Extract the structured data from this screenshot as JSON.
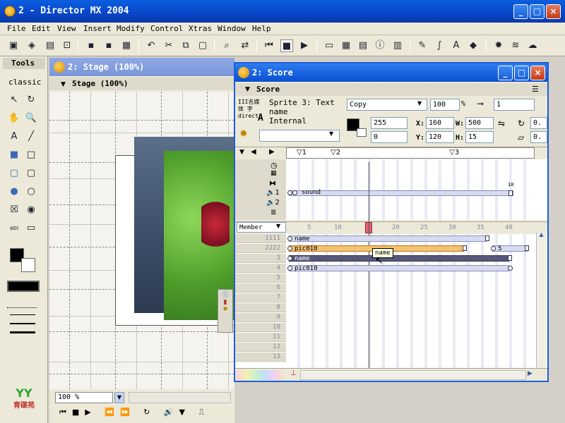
{
  "window": {
    "title": "2 - Director MX 2004"
  },
  "menu": [
    "File",
    "Edit",
    "View",
    "Insert",
    "Modify",
    "Control",
    "Xtras",
    "Window",
    "Help"
  ],
  "tools": {
    "title": "Tools",
    "mode": "classic"
  },
  "stage": {
    "title": "2: Stage (100%)",
    "subtitle": "Stage (100%)",
    "zoom": "100 %"
  },
  "score": {
    "title": "2: Score",
    "subtitle": "Score",
    "sprite_info": "Sprite 3: Text",
    "sprite_name_label": "name",
    "sprite_cast": "Internal",
    "thumb_text": "III名媒体 字 direct",
    "thumb_letter": "A",
    "ink": "Copy",
    "blend": "100",
    "blend_unit": "%",
    "frame_value": "1",
    "color_fg": "255",
    "color_bg": "0",
    "x_label": "X:",
    "x": "160",
    "y_label": "Y:",
    "y": "120",
    "w_label": "W:",
    "w": "500",
    "h_label": "H:",
    "h": "15",
    "rot": "0.",
    "skew": "0.",
    "markers": [
      "1",
      "2",
      "3"
    ],
    "display_mode": "Member",
    "sound_channel_1": "1",
    "sound_channel_2": "2",
    "frame_numbers": [
      "5",
      "10",
      "15",
      "20",
      "25",
      "30",
      "35",
      "40"
    ],
    "channel_numbers": [
      "1111",
      "2222",
      "3",
      "4",
      "5",
      "6",
      "7",
      "8",
      "9",
      "10",
      "11",
      "12",
      "13"
    ],
    "sprites": {
      "sound": "sound",
      "ch1": "name",
      "ch2": "pic010",
      "ch2b": "5",
      "ch3": "name",
      "ch4": "pic010",
      "tooltip": "name",
      "end_label": "10"
    }
  },
  "logo": {
    "text": "育碟苑"
  }
}
